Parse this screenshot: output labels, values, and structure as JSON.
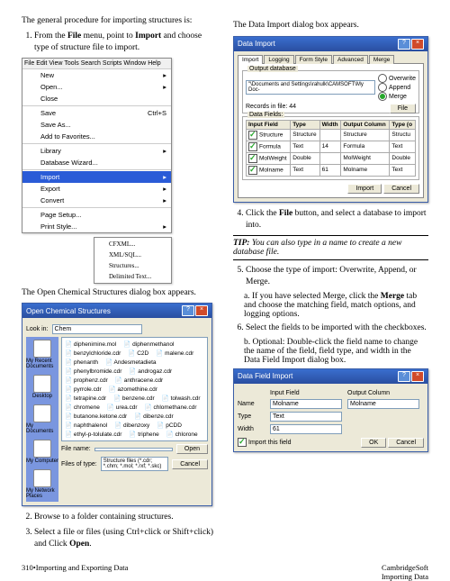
{
  "left": {
    "intro": "The general procedure for importing structures is:",
    "step1": "From the",
    "step1b": "File",
    "step1c": " menu, point to ",
    "step1d": "Import",
    "step1e": " and choose type of structure file to import.",
    "caption1": "The Open Chemical Structures dialog box appears.",
    "step2": "Browse to a folder containing structures.",
    "step3": "Select a file or files (using Ctrl+click or Shift+click) and Click ",
    "step3b": "Open",
    "step3c": "."
  },
  "ctx": {
    "topitems": [
      "File",
      "Edit",
      "View",
      "Tools",
      "Search",
      "Scripts",
      "Window",
      "Help"
    ],
    "items": [
      "New",
      "Open...",
      "Close",
      "Save",
      "Save As...",
      "Add to Favorites...",
      "Library",
      "Database Wizard..."
    ],
    "import": "Import",
    "export": "Export",
    "convert": "Convert",
    "shortcut": "Ctrl+S",
    "lower": [
      "Page Setup...",
      "Print Style..."
    ],
    "sub": [
      "CFXML...",
      "XML/SQL...",
      "Structures...",
      "Delimited Text..."
    ]
  },
  "fopen": {
    "title": "Open Chemical Structures",
    "look": "Look in:",
    "lookval": "Chem",
    "side": [
      "My Recent Documents",
      "Desktop",
      "My Documents",
      "My Computer",
      "My Network Places"
    ],
    "files": [
      "diphenimine.mol",
      "diphenmethanol",
      "benzylchloride.cdr",
      "C2D",
      "malene.cdr",
      "phenanth",
      "Andesmetadieta",
      "phenylbromide.cdr",
      "androgaz.cdr",
      "prophenz.cdr",
      "anthracene.cdr",
      "pyrrole.cdr",
      "azomethine.cdr",
      "tetrapine.cdr",
      "benzene.cdr",
      "tolwash.cdr",
      "chromene",
      "urea.cdr",
      "chlomethane.cdr",
      "butanone.ketone.cdr",
      "dibenze.cdr",
      "naphthalenol",
      "dibenzoxy",
      "pCDD",
      "ethyl-p-tolulate.cdr",
      "triphene",
      "chlorone"
    ],
    "fname": "File name:",
    "fopts": "Files of type:",
    "fval": "",
    "ftype": "Structure files (*.cdr; *.chm; *.mol; *.rxf; *.skc)",
    "open": "Open",
    "cancel": "Cancel"
  },
  "right": {
    "intro": "The Data Import dialog box appears.",
    "step4": "Click the ",
    "step4b": "File",
    "step4c": " button, and select a database to import into.",
    "tiplabel": "TIP:",
    "tip": " You can also type in a name to create a new database file.",
    "step5": "Choose the type of import: Overwrite, Append, or Merge.",
    "step5a": "If you have selected Merge, click the ",
    "step5aM": "Merge",
    "step5ab": " tab and choose the matching field, match options, and logging options.",
    "step6": "Select the fields to be imported with the checkboxes.",
    "step6b": "Optional: Double-click the field name to change the name of the field, field type, and width in the Data Field Import dialog box."
  },
  "dimp": {
    "title": "Data Import",
    "tabs": [
      "Import",
      "Logging",
      "Form Style",
      "Advanced",
      "Merge"
    ],
    "g1": "Output database",
    "path": "\"\\Documents and Settings\\rahulk\\CAMSOFT\\My Doc-",
    "recL": "Records in file:",
    "recV": "44",
    "fileBtn": "File",
    "r1": "Overwrite",
    "r2": "Append",
    "r3": "Merge",
    "g2": "Data Fields:",
    "cols": [
      "Input Field",
      "Type",
      "Width",
      "Output Column",
      "Type (o"
    ],
    "rows": [
      [
        "Structure",
        "Structure",
        "",
        "Structure",
        "Structu"
      ],
      [
        "Formula",
        "Text",
        "14",
        "Formula",
        "Text"
      ],
      [
        "MolWeight",
        "Double",
        "",
        "MolWeight",
        "Double"
      ],
      [
        "Molname",
        "Text",
        "61",
        "Molname",
        "Text"
      ]
    ],
    "ok": "Import",
    "cancel": "Cancel"
  },
  "dfi": {
    "title": "Data Field Import",
    "c1": "Input Field",
    "c2": "Output Column",
    "name": "Name",
    "type": "Type",
    "width": "Width",
    "vName": "Molname",
    "vType": "Text",
    "vWidth": "61",
    "oName": "Molname",
    "chk": "Import this field",
    "ok": "OK",
    "cancel": "Cancel"
  },
  "footer": {
    "l1": "310",
    "l2": "Importing and Exporting Data",
    "r1": "CambridgeSoft",
    "r2": "Importing Data"
  }
}
